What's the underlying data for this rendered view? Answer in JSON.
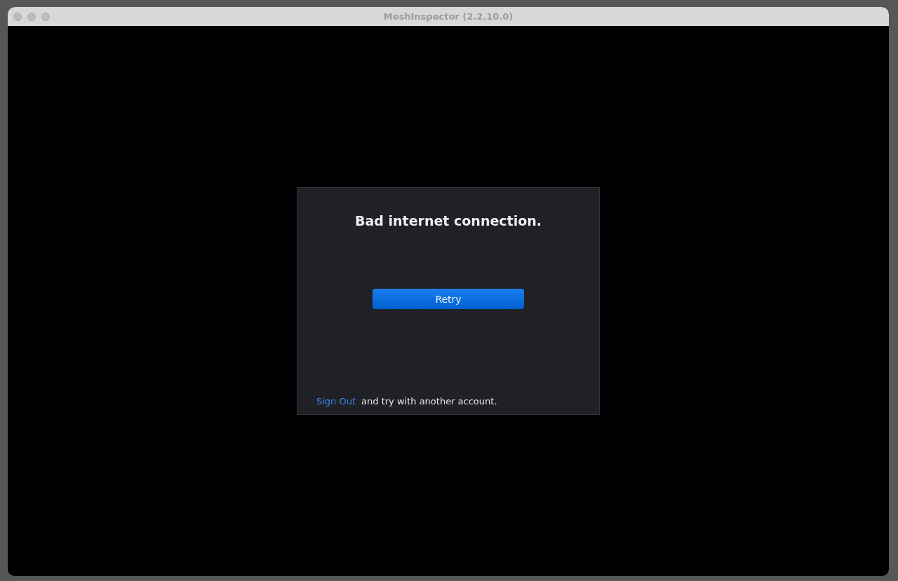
{
  "window": {
    "title": "MeshInspector (2.2.10.0)"
  },
  "dialog": {
    "message": "Bad internet connection.",
    "button": "Retry",
    "link": "Sign Out",
    "footer_text": "and try with another account."
  }
}
